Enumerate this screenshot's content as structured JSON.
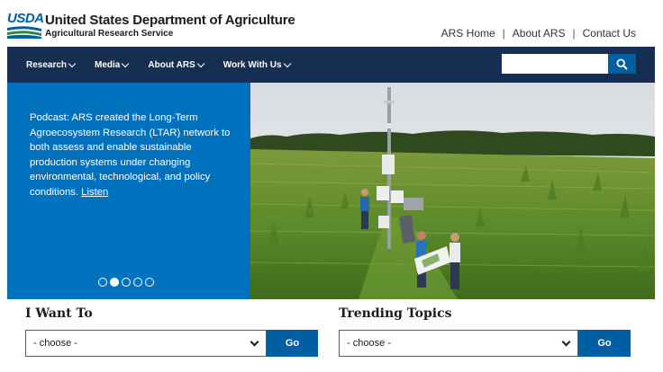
{
  "header": {
    "logo_text": "USDA",
    "agency_title": "United States Department of Agriculture",
    "agency_subtitle": "Agricultural Research Service",
    "top_links": [
      "ARS Home",
      "About ARS",
      "Contact Us"
    ],
    "separator": "|"
  },
  "nav": {
    "items": [
      {
        "label": "Research"
      },
      {
        "label": "Media"
      },
      {
        "label": "About ARS"
      },
      {
        "label": "Work With Us"
      }
    ],
    "search_placeholder": ""
  },
  "hero": {
    "text": "Podcast: ARS created the Long-Term Agroecosystem Research (LTAR) network to both assess and enable sustainable production systems under changing environmental, technological, and policy conditions.",
    "link_label": "Listen",
    "slide_count": 5,
    "active_slide": 2
  },
  "widgets": {
    "i_want_to": {
      "title": "I Want To",
      "selected": "- choose -",
      "button": "Go"
    },
    "trending": {
      "title": "Trending Topics",
      "selected": "- choose -",
      "button": "Go"
    }
  },
  "colors": {
    "nav_bg": "#162e51",
    "hero_bg": "#0071bc",
    "button_blue": "#005ea2"
  }
}
